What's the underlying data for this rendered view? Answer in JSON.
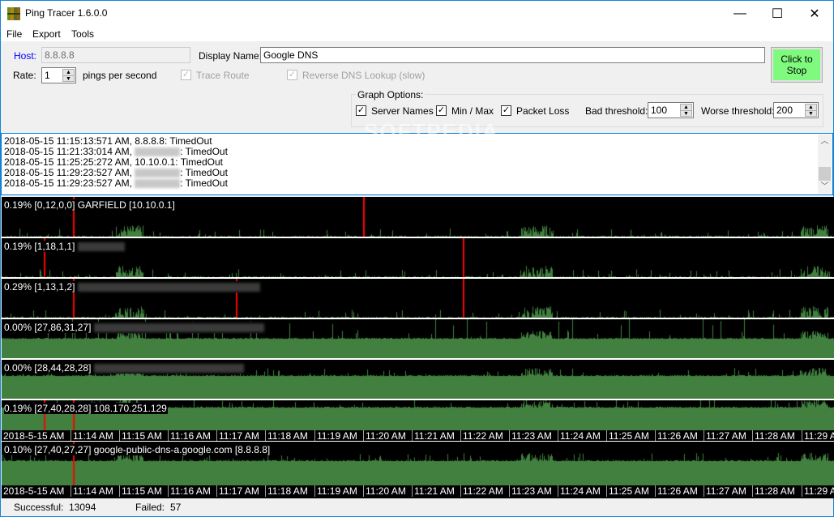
{
  "window": {
    "title": "Ping Tracer 1.6.0.0",
    "controls": {
      "minimize": "—",
      "maximize": "☐",
      "close": "✕"
    }
  },
  "menu": [
    "File",
    "Export",
    "Tools"
  ],
  "settings": {
    "host_label": "Host:",
    "host_value": "8.8.8.8",
    "display_name_label": "Display Name:",
    "display_name_value": "Google DNS",
    "rate_label": "Rate:",
    "rate_value": "1",
    "rate_unit": "pings per second",
    "trace_route_label": "Trace Route",
    "trace_route_checked": true,
    "reverse_dns_label": "Reverse DNS Lookup (slow)",
    "reverse_dns_checked": true,
    "start_stop_label": "Click to Stop",
    "start_stop_color": "#7ffa7f"
  },
  "graph_options": {
    "title": "Graph Options:",
    "server_names_label": "Server Names",
    "server_names_checked": true,
    "min_max_label": "Min / Max",
    "min_max_checked": true,
    "packet_loss_label": "Packet Loss",
    "packet_loss_checked": true,
    "bad_threshold_label": "Bad threshold:",
    "bad_threshold_value": "100",
    "worse_threshold_label": "Worse threshold:",
    "worse_threshold_value": "200"
  },
  "watermark": "SOFTPEDIA",
  "log": [
    {
      "time": "2018-05-15 11:15:13:571 AM, ",
      "host": "8.8.8.8",
      "blurred": false,
      "status": ": TimedOut"
    },
    {
      "time": "2018-05-15 11:21:33:014 AM, ",
      "host": "",
      "blurred": true,
      "status": ": TimedOut"
    },
    {
      "time": "2018-05-15 11:25:25:272 AM, ",
      "host": "10.10.0.1",
      "blurred": false,
      "status": ": TimedOut"
    },
    {
      "time": "2018-05-15 11:29:23:527 AM, ",
      "host": "",
      "blurred": true,
      "status": ": TimedOut"
    },
    {
      "time": "2018-05-15 11:29:23:527 AM, ",
      "host": "",
      "blurred": true,
      "status": ": TimedOut"
    }
  ],
  "colors": {
    "ping_bar": "#41803f",
    "timeout_line": "#ff0000",
    "graph_bg": "#000000"
  },
  "graphs": [
    {
      "label": "0.19% [0,12,0,0] GARFIELD [10.10.0.1]",
      "blurred_suffix": false,
      "loss_pct": 0.19,
      "min": 0,
      "avg": 12,
      "median": 0,
      "max": 0,
      "baseline": 0.02,
      "timeouts_min": [
        1.05,
        7.0
      ]
    },
    {
      "label": "0.19% [1,18,1,1]",
      "blurred_suffix": true,
      "loss_pct": 0.19,
      "min": 1,
      "avg": 18,
      "median": 1,
      "max": 1,
      "baseline": 0.02,
      "timeouts_min": [
        0.45,
        9.05
      ]
    },
    {
      "label": "0.29% [1,13,1,2]",
      "blurred_suffix": true,
      "loss_pct": 0.29,
      "min": 1,
      "avg": 13,
      "median": 1,
      "max": 2,
      "baseline": 0.02,
      "timeouts_min": [
        1.05,
        4.4,
        9.05
      ]
    },
    {
      "label": "0.00% [27,86,31,27]",
      "blurred_suffix": true,
      "loss_pct": 0.0,
      "min": 27,
      "avg": 86,
      "median": 31,
      "max": 27,
      "baseline": 0.5,
      "timeouts_min": []
    },
    {
      "label": "0.00% [28,44,28,28]",
      "blurred_suffix": true,
      "loss_pct": 0.0,
      "min": 28,
      "avg": 44,
      "median": 28,
      "max": 28,
      "baseline": 0.6,
      "timeouts_min": []
    },
    {
      "label": "0.19% [27,40,28,28] 108.170.251.129",
      "blurred_suffix": false,
      "loss_pct": 0.19,
      "min": 27,
      "avg": 40,
      "median": 28,
      "max": 28,
      "baseline": 0.75,
      "timeouts_min": [
        0.45,
        1.05
      ]
    },
    {
      "label": "0.10% [27,40,27,27] google-public-dns-a.google.com [8.8.8.8]",
      "blurred_suffix": false,
      "loss_pct": 0.1,
      "min": 27,
      "avg": 40,
      "median": 27,
      "max": 27,
      "baseline": 0.55,
      "timeouts_min": [
        1.05
      ]
    }
  ],
  "time_axis": [
    "2018-5-15  AM",
    "11:14 AM",
    "11:15 AM",
    "11:16 AM",
    "11:17 AM",
    "11:18 AM",
    "11:19 AM",
    "11:20 AM",
    "11:21 AM",
    "11:22 AM",
    "11:23 AM",
    "11:24 AM",
    "11:25 AM",
    "11:26 AM",
    "11:27 AM",
    "11:28 AM",
    "11:29 AM"
  ],
  "status": {
    "successful_label": "Successful:",
    "successful_value": "13094",
    "failed_label": "Failed:",
    "failed_value": "57"
  }
}
